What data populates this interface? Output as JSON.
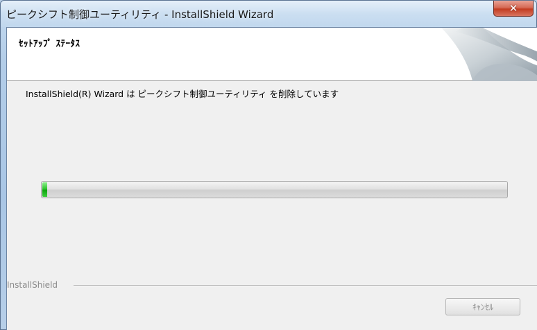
{
  "window": {
    "title": "ピークシフト制御ユーティリティ - InstallShield Wizard",
    "close_icon": "close-icon"
  },
  "header": {
    "title": "ｾｯﾄｱｯﾌﾟ ｽﾃｰﾀｽ"
  },
  "main": {
    "message": "InstallShield(R) Wizard は ピークシフト制御ユーティリティ を削除しています",
    "progress": {
      "fraction": 0.01,
      "color": "#1db51d"
    }
  },
  "footer": {
    "brand": "InstallShield",
    "cancel_label": "ｷｬﾝｾﾙ"
  }
}
